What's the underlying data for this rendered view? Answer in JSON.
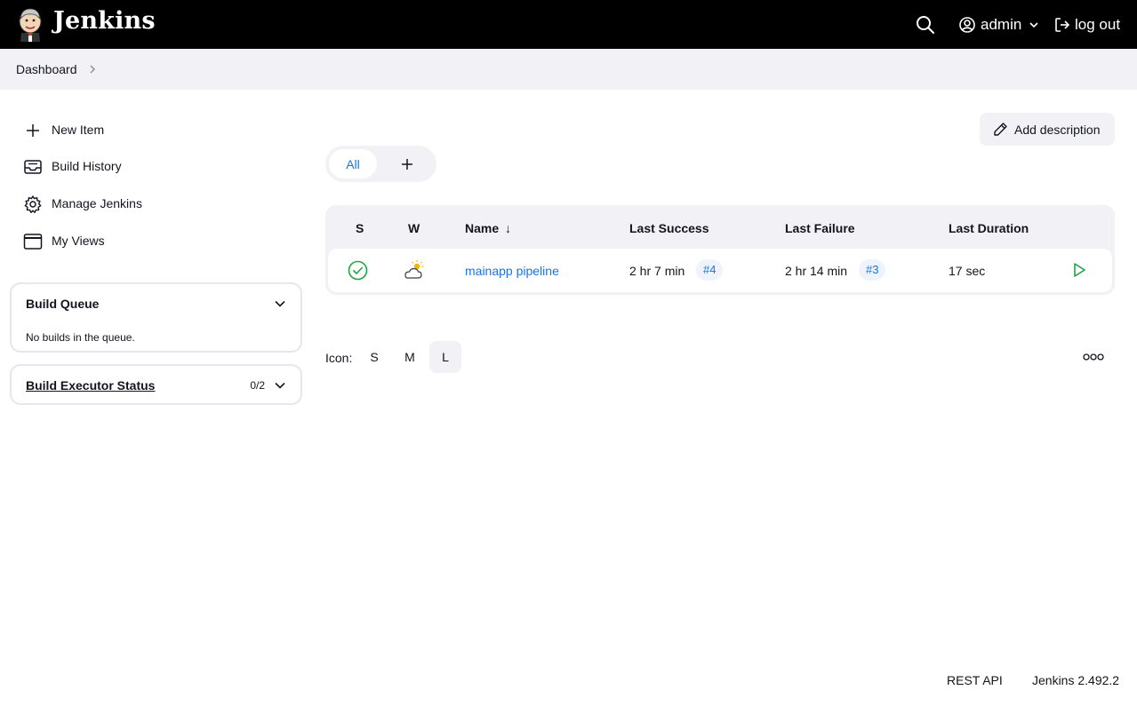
{
  "header": {
    "brand": "Jenkins",
    "user": "admin",
    "logout_label": "log out"
  },
  "breadcrumb": {
    "items": [
      "Dashboard"
    ]
  },
  "sidebar": {
    "tasks": [
      {
        "label": "New Item",
        "icon": "plus-icon"
      },
      {
        "label": "Build History",
        "icon": "inbox-icon"
      },
      {
        "label": "Manage Jenkins",
        "icon": "gear-icon"
      },
      {
        "label": "My Views",
        "icon": "window-icon"
      }
    ],
    "build_queue": {
      "title": "Build Queue",
      "empty_text": "No builds in the queue."
    },
    "executor_status": {
      "title": "Build Executor Status",
      "count": "0/2"
    }
  },
  "main": {
    "add_description_label": "Add description",
    "tabs": {
      "active": "All"
    },
    "table": {
      "headers": {
        "status": "S",
        "weather": "W",
        "name": "Name",
        "sort_indicator": "↓",
        "last_success": "Last Success",
        "last_failure": "Last Failure",
        "last_duration": "Last Duration"
      },
      "rows": [
        {
          "status_icon": "success-check-icon",
          "weather_icon": "partly-cloudy-icon",
          "name": "mainapp pipeline",
          "last_success": "2 hr 7 min",
          "last_success_build": "#4",
          "last_failure": "2 hr 14 min",
          "last_failure_build": "#3",
          "last_duration": "17 sec",
          "action_icon": "play-icon"
        }
      ]
    },
    "icon_size": {
      "label": "Icon:",
      "options": [
        "S",
        "M",
        "L"
      ],
      "selected": "L"
    }
  },
  "footer": {
    "rest_api": "REST API",
    "version": "Jenkins 2.492.2"
  },
  "colors": {
    "header_bg": "#000000",
    "accent": "#1a73e8",
    "success": "#1ea446",
    "panel_bg": "#f1f1f6"
  }
}
